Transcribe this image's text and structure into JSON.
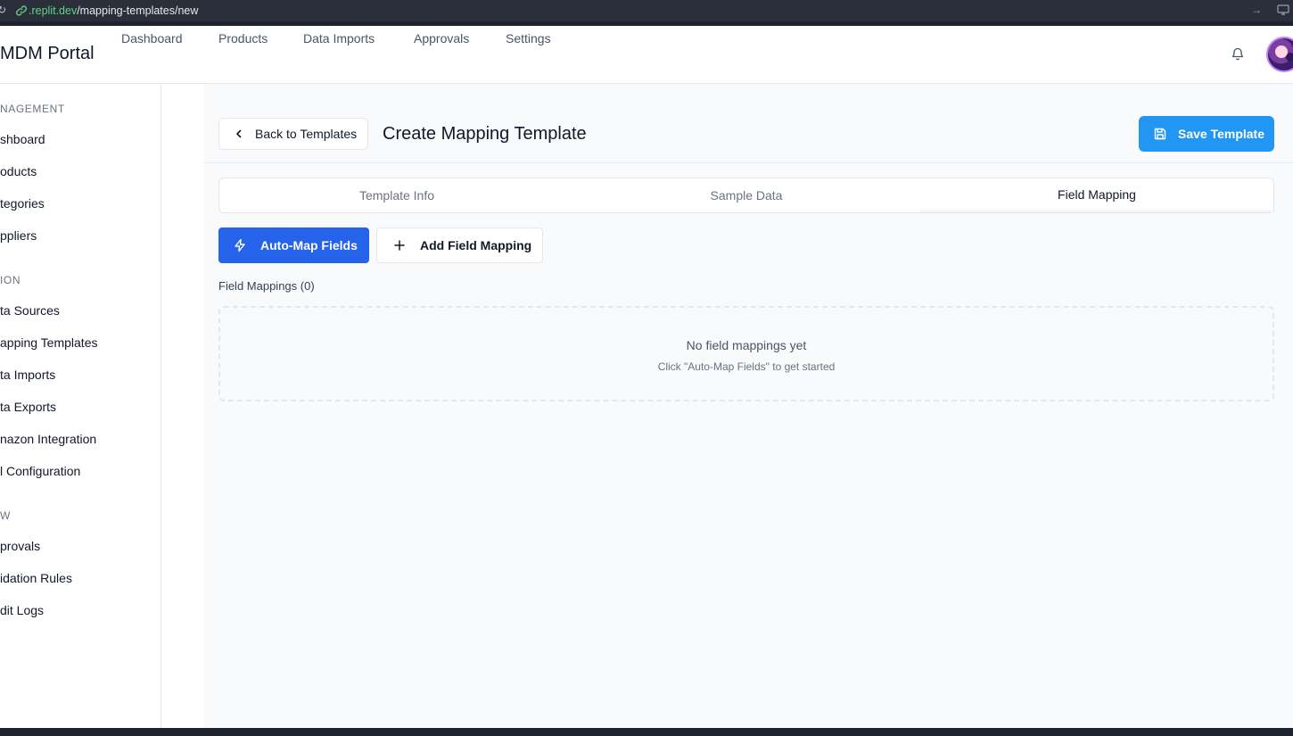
{
  "browser": {
    "url_domain": ".replit.dev",
    "url_path": "/mapping-templates/new"
  },
  "header": {
    "brand": "MDM Portal",
    "nav": [
      "Dashboard",
      "Products",
      "Data Imports",
      "Approvals",
      "Settings"
    ]
  },
  "sidebar": {
    "sections": [
      {
        "title": "NAGEMENT",
        "items": [
          "shboard",
          "oducts",
          "tegories",
          "ppliers"
        ]
      },
      {
        "title": "ION",
        "items": [
          "ta Sources",
          "apping Templates",
          "ta Imports",
          "ta Exports",
          "nazon Integration",
          "l Configuration"
        ]
      },
      {
        "title": "W",
        "items": [
          "provals",
          "idation Rules",
          "dit Logs"
        ]
      }
    ]
  },
  "page": {
    "back_label": "Back to Templates",
    "title": "Create Mapping Template",
    "save_label": "Save Template",
    "tabs": [
      "Template Info",
      "Sample Data",
      "Field Mapping"
    ],
    "active_tab": "Field Mapping",
    "auto_map_label": "Auto-Map Fields",
    "add_mapping_label": "Add Field Mapping",
    "field_mappings_label": "Field Mappings (0)",
    "empty_title": "No field mappings yet",
    "empty_hint": "Click \"Auto-Map Fields\" to get started"
  },
  "colors": {
    "save_button": "#2196f3",
    "auto_map_button": "#2563eb",
    "url_domain": "#5fd38a"
  }
}
